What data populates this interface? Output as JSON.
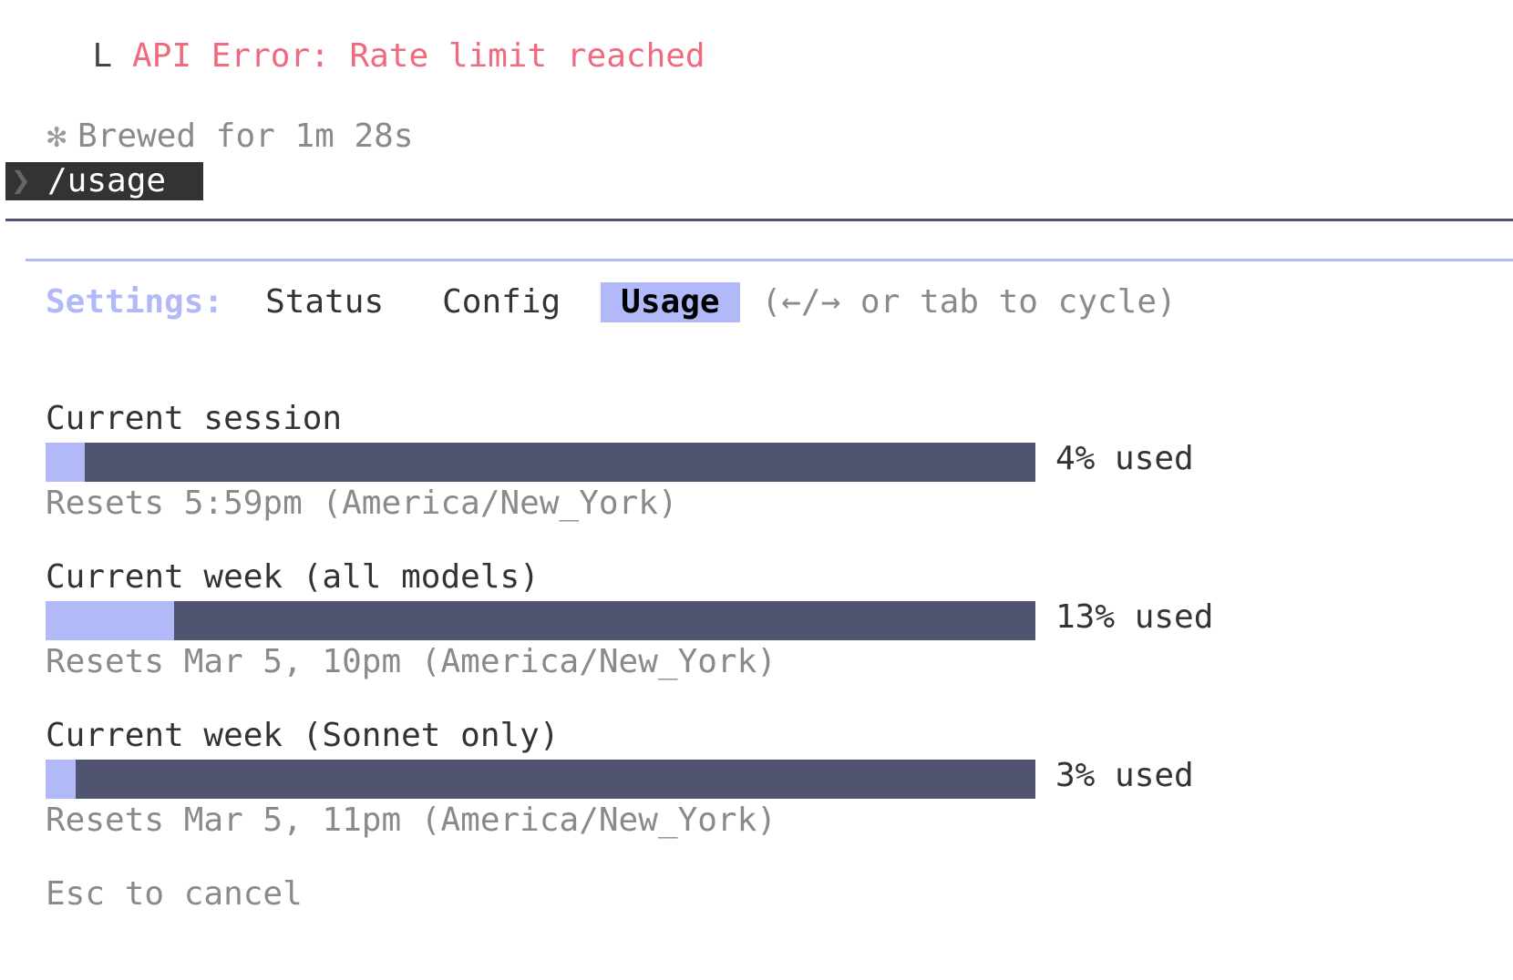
{
  "error": {
    "corner": "L",
    "message": "API Error: Rate limit reached"
  },
  "status": {
    "spinner": "✻",
    "text": "Brewed for 1m 28s"
  },
  "prompt": {
    "chevron": "❯",
    "command": "/usage"
  },
  "tabs": {
    "label": "Settings:",
    "items": [
      "Status",
      "Config",
      "Usage"
    ],
    "active": "Usage",
    "hint": "(←/→ or tab to cycle)"
  },
  "usage": [
    {
      "label": "Current session",
      "percent": 4,
      "percent_text": "4% used",
      "reset": "Resets 5:59pm (America/New_York)"
    },
    {
      "label": "Current week (all models)",
      "percent": 13,
      "percent_text": "13% used",
      "reset": "Resets Mar 5, 10pm (America/New_York)"
    },
    {
      "label": "Current week (Sonnet only)",
      "percent": 3,
      "percent_text": "3% used",
      "reset": "Resets Mar 5, 11pm (America/New_York)"
    }
  ],
  "footer": {
    "hint": "Esc to cancel"
  },
  "colors": {
    "error": "#f06a7e",
    "accent": "#b1b9f9",
    "bar_track": "#505470",
    "muted": "#8a8a8a",
    "text": "#333333"
  }
}
